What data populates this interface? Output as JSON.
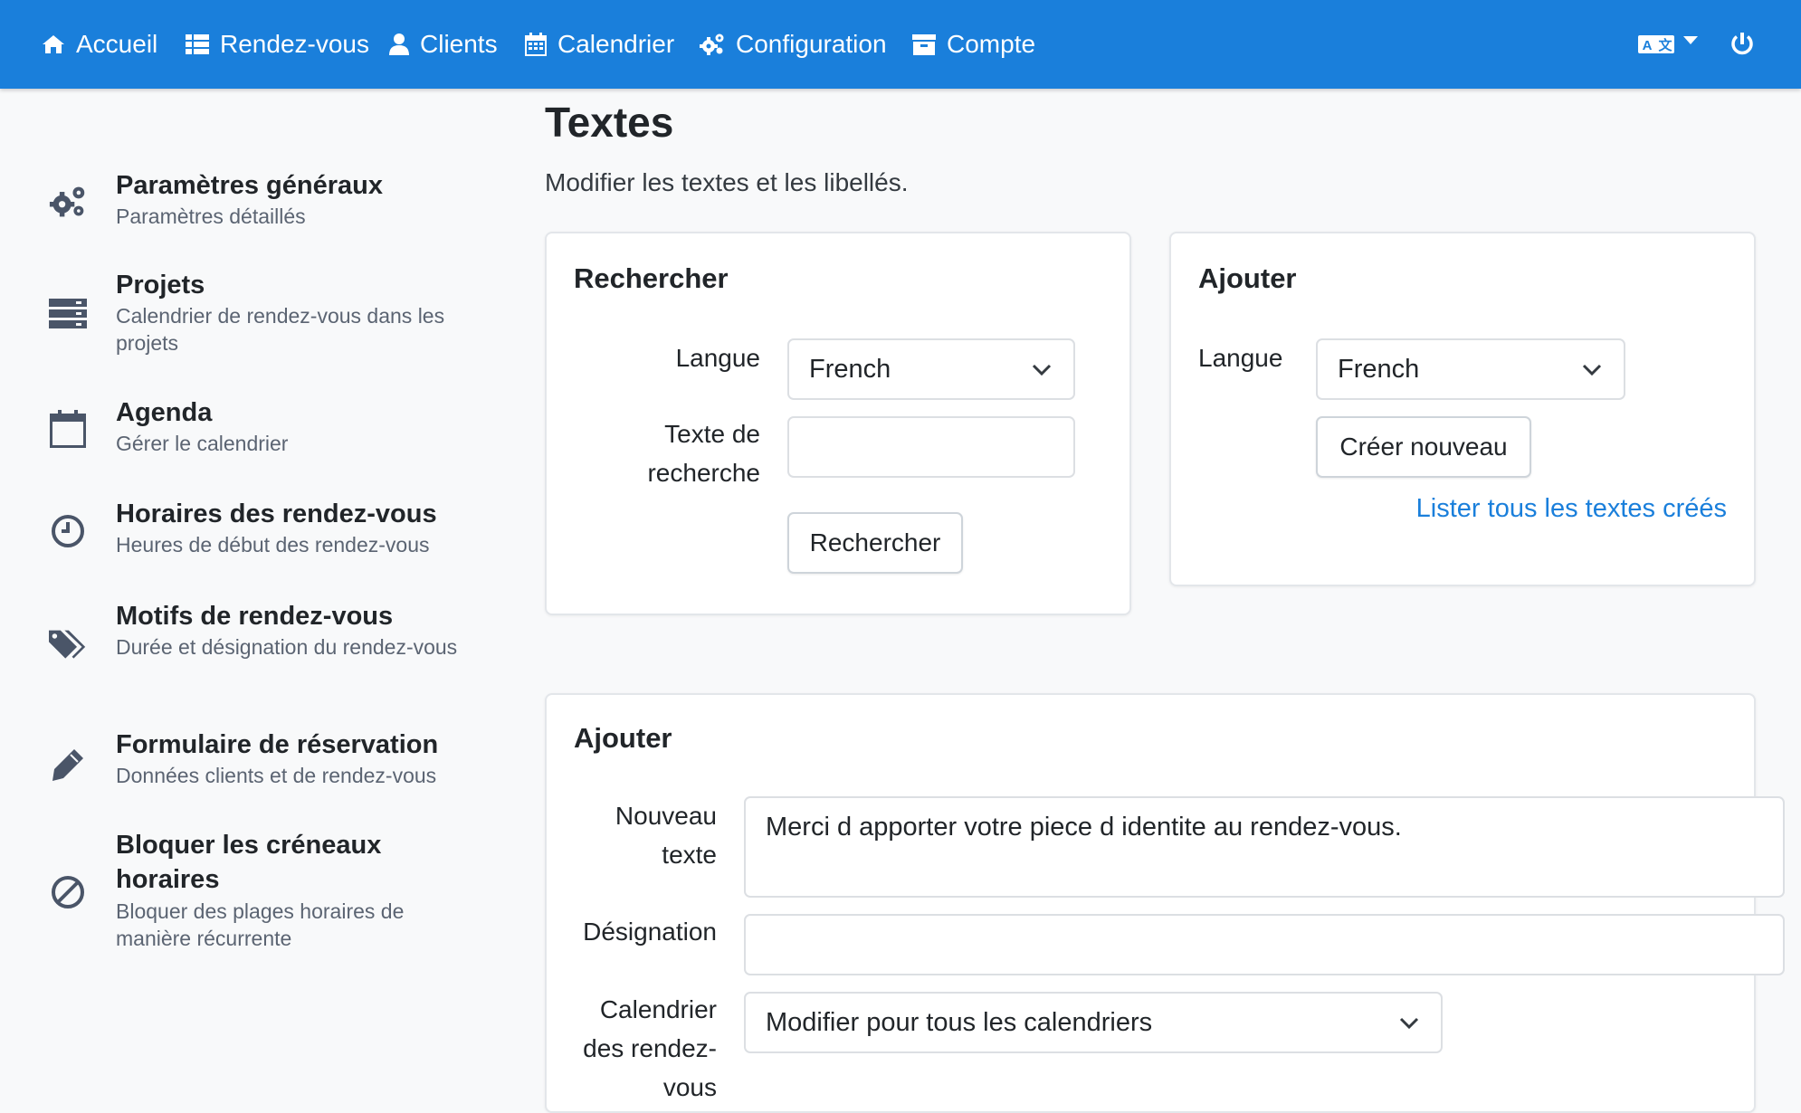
{
  "navbar": {
    "items": [
      {
        "label": "Accueil",
        "icon": "home-icon"
      },
      {
        "label": "Rendez-vous",
        "icon": "list-icon"
      },
      {
        "label": "Clients",
        "icon": "user-icon"
      },
      {
        "label": "Calendrier",
        "icon": "calendar-icon"
      },
      {
        "label": "Configuration",
        "icon": "cogs-icon"
      },
      {
        "label": "Compte",
        "icon": "archive-icon"
      }
    ],
    "language_icon": "language-icon",
    "logout_icon": "power-icon",
    "color": "#1a7fdb"
  },
  "sidebar": {
    "items": [
      {
        "title": "Paramètres généraux",
        "subtitle": "Paramètres détaillés",
        "icon": "cogs-icon"
      },
      {
        "title": "Projets",
        "subtitle": "Calendrier de rendez-vous dans les projets",
        "icon": "server-icon"
      },
      {
        "title": "Agenda",
        "subtitle": "Gérer le calendrier",
        "icon": "calendar-icon"
      },
      {
        "title": "Horaires des rendez-vous",
        "subtitle": "Heures de début des rendez-vous",
        "icon": "clock-icon"
      },
      {
        "title": "Motifs de rendez-vous",
        "subtitle": "Durée et désignation du rendez-vous",
        "icon": "tags-icon"
      },
      {
        "title": "Formulaire de réservation",
        "subtitle": "Données clients et de rendez-vous",
        "icon": "pencil-icon"
      },
      {
        "title": "Bloquer les créneaux horaires",
        "subtitle": "Bloquer des plages horaires de manière récurrente",
        "icon": "ban-icon"
      }
    ]
  },
  "main": {
    "title": "Textes",
    "subtitle": "Modifier les textes et les libellés.",
    "search_card": {
      "title": "Rechercher",
      "language_label": "Langue",
      "language_value": "French",
      "search_text_label": "Texte de recherche",
      "search_text_value": "",
      "search_button": "Rechercher"
    },
    "add_card": {
      "title": "Ajouter",
      "language_label": "Langue",
      "language_value": "French",
      "create_button": "Créer nouveau",
      "list_link": "Lister tous les textes créés"
    },
    "add_form": {
      "title": "Ajouter",
      "new_text_label": "Nouveau texte",
      "new_text_value": "Merci d apporter votre piece d identite au rendez-vous.",
      "designation_label": "Désignation",
      "designation_value": "",
      "calendar_label": "Calendrier des rendez-vous",
      "calendar_value": "Modifier pour tous les calendriers"
    }
  }
}
